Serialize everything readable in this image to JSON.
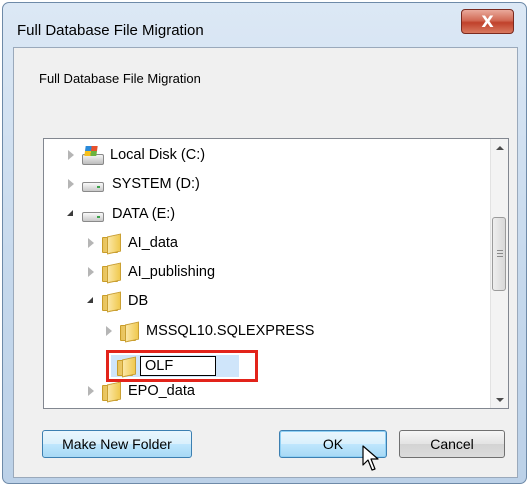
{
  "window": {
    "title": "Full Database File Migration",
    "close_symbol": "X"
  },
  "dialog": {
    "description": "Full Database File Migration"
  },
  "tree": {
    "items": [
      {
        "label": "Local Disk (C:)",
        "icon": "windows-drive-icon",
        "expander": "collapsed",
        "level": 0
      },
      {
        "label": "SYSTEM (D:)",
        "icon": "drive-icon",
        "expander": "collapsed",
        "level": 0
      },
      {
        "label": "DATA (E:)",
        "icon": "drive-icon",
        "expander": "expanded",
        "level": 0
      },
      {
        "label": "AI_data",
        "icon": "folder-icon",
        "expander": "collapsed",
        "level": 1
      },
      {
        "label": "AI_publishing",
        "icon": "folder-icon",
        "expander": "collapsed",
        "level": 1
      },
      {
        "label": "DB",
        "icon": "folder-icon",
        "expander": "expanded",
        "level": 1
      },
      {
        "label": "MSSQL10.SQLEXPRESS",
        "icon": "folder-icon",
        "expander": "collapsed",
        "level": 2
      },
      {
        "label": "EPO_data",
        "icon": "folder-icon",
        "expander": "collapsed",
        "level": 1
      }
    ],
    "new_folder_edit_value": "OLF"
  },
  "buttons": {
    "make_new_folder": "Make New Folder",
    "ok": "OK",
    "cancel": "Cancel"
  },
  "colors": {
    "highlight_border": "#e2231a",
    "selection": "#cfe5fa"
  }
}
